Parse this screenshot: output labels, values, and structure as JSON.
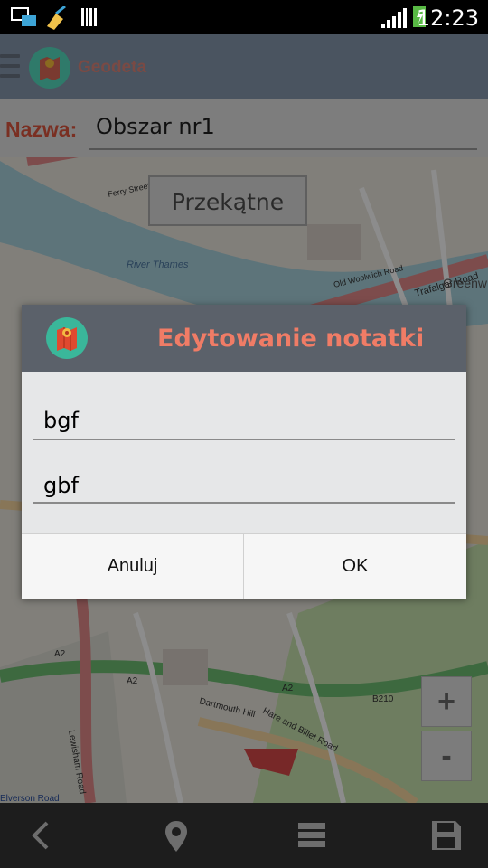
{
  "status_bar": {
    "time": "12:23"
  },
  "app_bar": {
    "title": "Geodeta",
    "menu_icon": "hamburger-icon",
    "logo_icon": "map-logo-icon"
  },
  "name_bar": {
    "label": "Nazwa:",
    "value": "Obszar nr1"
  },
  "map": {
    "diagonal_button": "Przekątne",
    "zoom_in": "+",
    "zoom_out": "-",
    "labels": {
      "river": "River Thames",
      "trafalgar": "Trafalgar Road",
      "woolwich": "Old Woolwich Road",
      "greenwich": "Greenw",
      "a2_1": "A2",
      "a2_2": "A2",
      "a2_3": "A2",
      "b210": "B210",
      "dartmouth": "Dartmouth Hill",
      "hare": "Hare and Billet Road",
      "elverson": "Elverson Road",
      "lewisham": "Lewisham Road",
      "ferry": "Ferry Street"
    }
  },
  "dialog": {
    "title": "Edytowanie notatki",
    "field1": "bgf",
    "field2": "gbf",
    "cancel": "Anuluj",
    "ok": "OK"
  },
  "nav_bar": {
    "icons": [
      "back-icon",
      "location-pin-icon",
      "list-icon",
      "save-icon"
    ]
  },
  "colors": {
    "dialog_title": "#f07c66",
    "app_bar": "#4a5460",
    "dialog_head": "#5b616a"
  }
}
